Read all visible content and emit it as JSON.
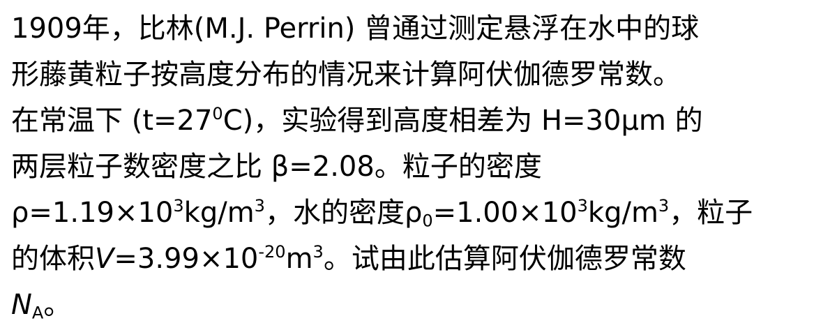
{
  "problem": {
    "line1": "1909年，比林(M.J. Perrin) 曾通过测定悬浮在水中的球",
    "line2": "形藤黄粒子按高度分布的情况来计算阿伏伽德罗常数。",
    "line3": {
      "a": "在常温下 (t=27",
      "sup": "0",
      "b": "C)，实验得到高度相差为 H=30μm 的"
    },
    "line4": "两层粒子数密度之比 β=2.08。粒子的密度",
    "line5": {
      "a": "ρ=1.19×10",
      "sup1": "3",
      "b": "kg/m",
      "sup2": "3",
      "c": "，水的密度ρ",
      "sub": "0",
      "d": "=1.00×10",
      "sup3": "3",
      "e": "kg/m",
      "sup4": "3",
      "f": "，粒子"
    },
    "line6": {
      "a": "的体积",
      "var": "V",
      "b": "=3.99×10",
      "sup1": "-20",
      "c": "m",
      "sup2": "3",
      "d": "。试由此估算阿伏伽德罗常数"
    },
    "line7": {
      "var": "N",
      "sub": "A",
      "end": "。"
    }
  }
}
